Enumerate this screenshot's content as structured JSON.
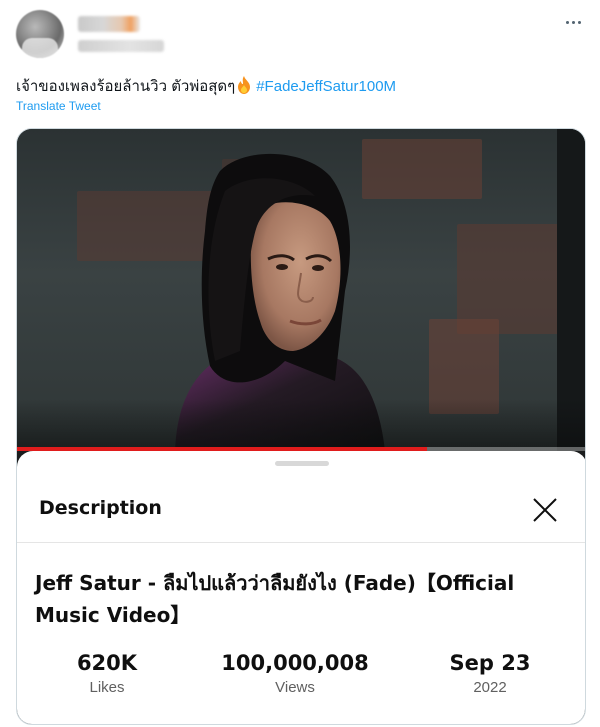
{
  "tweet": {
    "text_thai": "เจ้าของเพลงร้อยล้านวิว ตัวพ่อสุดๆ",
    "fire_emoji": "🔥",
    "hashtag": "#FadeJeffSatur100M",
    "translate_label": "Translate Tweet"
  },
  "media": {
    "progress_fraction": 0.72,
    "progress_color": "#e01c1c",
    "sheet": {
      "title": "Description",
      "video_title": "Jeff Satur - ลืมไปแล้วว่าลืมยังไง (Fade)【Official Music Video】",
      "stats": [
        {
          "value": "620K",
          "label": "Likes"
        },
        {
          "value": "100,000,008",
          "label": "Views"
        },
        {
          "value": "Sep 23",
          "label": "2022"
        }
      ]
    }
  },
  "colors": {
    "link": "#1d9bf0",
    "text": "#0f1419"
  },
  "icons": {
    "more": "more-icon",
    "close": "close-icon",
    "fire": "fire-emoji-icon"
  }
}
